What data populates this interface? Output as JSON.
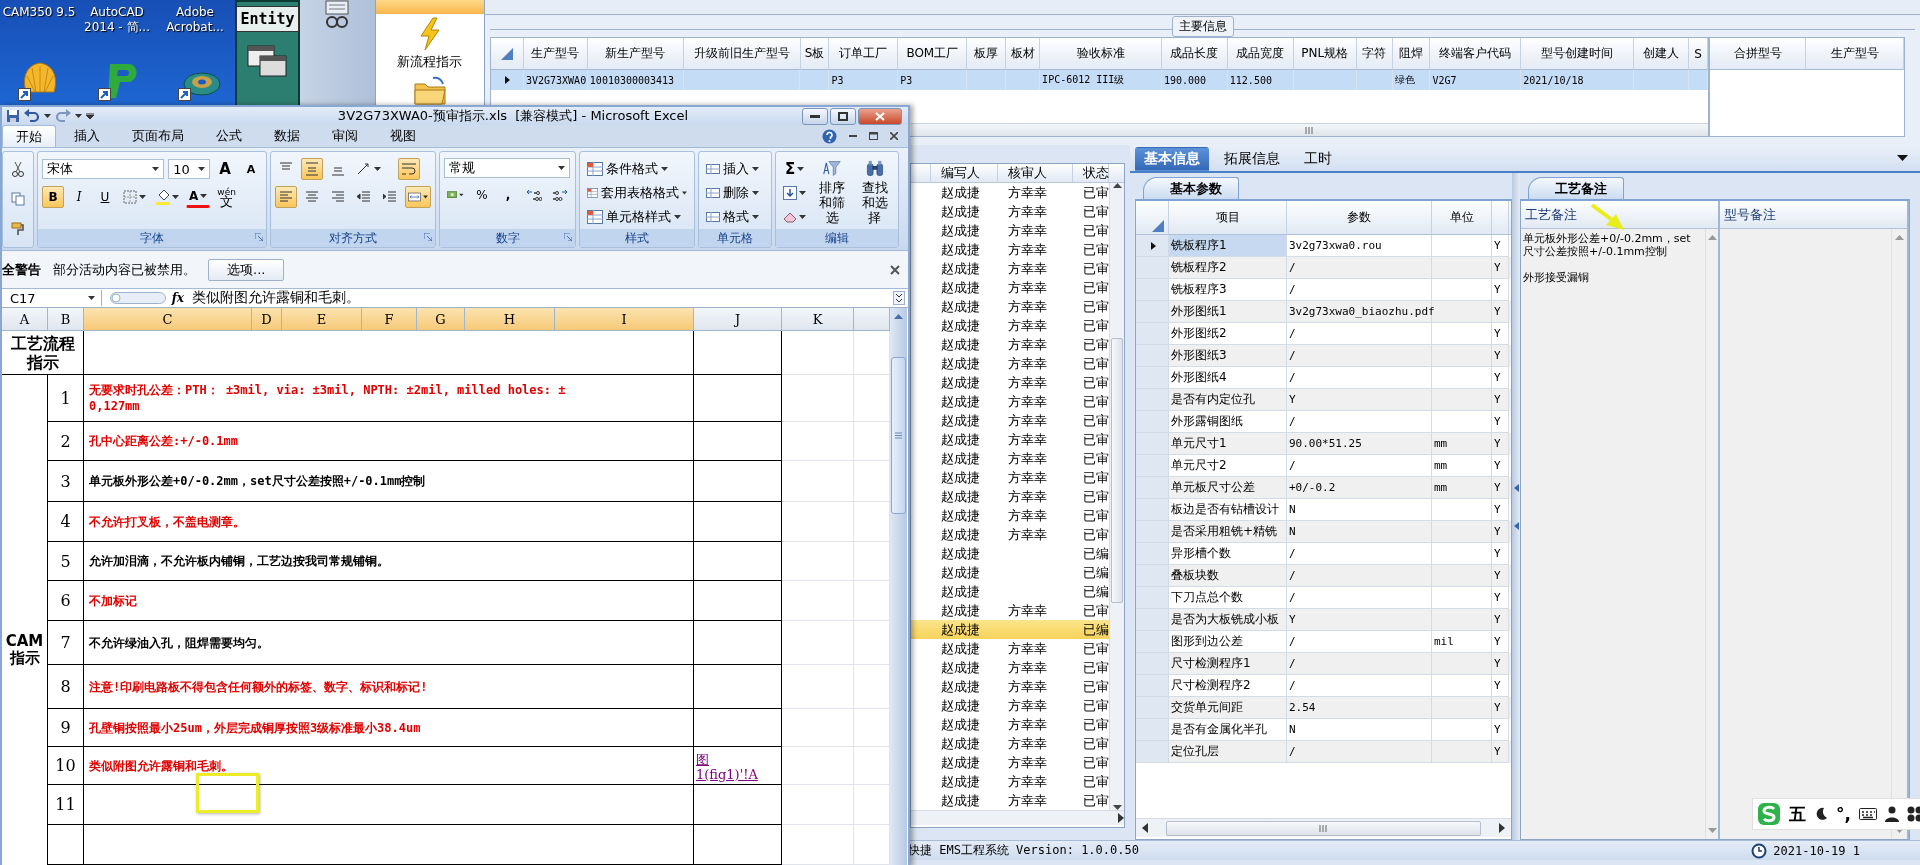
{
  "desktop_icons": [
    {
      "label": "CAM350 9.5"
    },
    {
      "label": "AutoCAD\n2014 - 简..."
    },
    {
      "label": "Adobe\nAcrobat..."
    }
  ],
  "entity_window": {
    "title": "Entity"
  },
  "nav_panel": {
    "items": [
      {
        "label": "新流程指示"
      }
    ]
  },
  "main_info": {
    "caption": "主要信息",
    "row": {
      "selected": true
    },
    "columns": [
      {
        "label": "生产型号",
        "value": "3V2G73XWA0"
      },
      {
        "label": "新生产型号",
        "value": "10010300003413"
      },
      {
        "label": "升级前旧生产型号"
      },
      {
        "label": "S板"
      },
      {
        "label": "订单工厂",
        "value": "P3"
      },
      {
        "label": "BOM工厂",
        "value": "P3"
      },
      {
        "label": "板厚"
      },
      {
        "label": "板材"
      },
      {
        "label": "验收标准",
        "value": "IPC-6012 III级"
      },
      {
        "label": "成品长度",
        "value": "190.000"
      },
      {
        "label": "成品宽度",
        "value": "112.500"
      },
      {
        "label": "PNL规格"
      },
      {
        "label": "字符"
      },
      {
        "label": "阻焊",
        "value": "绿色"
      },
      {
        "label": "终端客户代码",
        "value": "V2G7"
      },
      {
        "label": "型号创建时间",
        "value": "2021/10/18"
      },
      {
        "label": "创建人"
      },
      {
        "label": "S"
      }
    ]
  },
  "side_table": {
    "columns": [
      "合拼型号",
      "生产型号"
    ]
  },
  "excel": {
    "title": "3V2G73XWA0-预审指示.xls  [兼容模式] - Microsoft Excel",
    "tabs": [
      {
        "label": "开始",
        "selected": true
      },
      {
        "label": "插入",
        "selected": false
      },
      {
        "label": "页面布局",
        "selected": false
      },
      {
        "label": "公式",
        "selected": false
      },
      {
        "label": "数据",
        "selected": false
      },
      {
        "label": "审阅",
        "selected": false
      },
      {
        "label": "视图",
        "selected": false
      }
    ],
    "ribbon": {
      "font": "宋体",
      "font_size": "10",
      "grow_font": "A",
      "shrink_font": "A",
      "font_color": "A",
      "phonetic_top": "wén",
      "phonetic": "文",
      "format_buttons": [
        {
          "label": "B",
          "on": true
        },
        {
          "label": "I",
          "on": false
        },
        {
          "label": "U",
          "on": false
        }
      ],
      "align_buttons": [
        {
          "kind": "top",
          "on": false
        },
        {
          "kind": "middle",
          "on": true
        },
        {
          "kind": "bottom",
          "on": false
        },
        {
          "kind": "left",
          "on": true
        },
        {
          "kind": "center",
          "on": false
        },
        {
          "kind": "right",
          "on": false
        }
      ],
      "wrap_on": true,
      "merge_on": true,
      "number_format": "常规",
      "percent": "%",
      "comma": ",",
      "style_buttons": [
        "条件格式",
        "套用表格格式",
        "单元格样式"
      ],
      "cell_buttons": [
        "插入",
        "删除",
        "格式"
      ],
      "sum": "Σ",
      "edit_buttons": [
        "排序和筛选",
        "查找和选择"
      ],
      "groups": [
        "字体",
        "对齐方式",
        "数字",
        "样式",
        "单元格",
        "编辑"
      ]
    },
    "security_bar": {
      "title": "全警告",
      "message": "部分活动内容已被禁用。",
      "button": "选项..."
    },
    "formula_bar": {
      "cell": "C17",
      "fx": "fx",
      "content": "类似附图允许露铜和毛刺。"
    },
    "sheet": {
      "columns": [
        {
          "label": "A",
          "selected": false
        },
        {
          "label": "B",
          "selected": false
        },
        {
          "label": "C",
          "selected": true
        },
        {
          "label": "D",
          "selected": true
        },
        {
          "label": "E",
          "selected": true
        },
        {
          "label": "F",
          "selected": true
        },
        {
          "label": "G",
          "selected": true
        },
        {
          "label": "H",
          "selected": true
        },
        {
          "label": "I",
          "selected": true
        },
        {
          "label": "J",
          "selected": false
        },
        {
          "label": "K",
          "selected": false
        }
      ],
      "header": "工艺流程指示",
      "section": "CAM\n指示",
      "rows": [
        {
          "number": "1",
          "text": "无要求时孔公差：PTH： ±3mil, via: ±3mil, NPTH: ±2mil, milled holes: ±\n0,127mm",
          "color": "#e00000"
        },
        {
          "number": "2",
          "text": "孔中心距离公差:+/-0.1mm",
          "color": "#e00000"
        },
        {
          "number": "3",
          "text": "单元板外形公差+0/-0.2mm，set尺寸公差按照+/-0.1mm控制",
          "color": "#000000"
        },
        {
          "number": "4",
          "text": "不允许打叉板，不盖电测章。",
          "color": "#e00000"
        },
        {
          "number": "5",
          "text": "允许加泪滴，不允许板内铺铜，工艺边按我司常规铺铜。",
          "color": "#000000"
        },
        {
          "number": "6",
          "text": "不加标记",
          "color": "#e00000"
        },
        {
          "number": "7",
          "text": "不允许绿油入孔，阻焊需要均匀。",
          "color": "#000000"
        },
        {
          "number": "8",
          "text": "注意!印刷电路板不得包含任何额外的标签、数字、标识和标记!",
          "color": "#e00000"
        },
        {
          "number": "9",
          "text": "孔壁铜按照最小25um，外层完成铜厚按照3级标准最小38.4um",
          "color": "#e00000"
        },
        {
          "number": "10",
          "text": "类似附图允许露铜和毛刺。",
          "color": "#e00000",
          "link": "图\n1(fig1)'!A"
        },
        {
          "number": "11"
        }
      ]
    }
  },
  "list": {
    "columns": [
      "编写人",
      "核审人",
      "状态"
    ],
    "rows": [
      {
        "writer": "赵成捷",
        "reviewer": "方幸幸",
        "status": "已审",
        "selected": false
      },
      {
        "writer": "赵成捷",
        "reviewer": "方幸幸",
        "status": "已审",
        "selected": false
      },
      {
        "writer": "赵成捷",
        "reviewer": "方幸幸",
        "status": "已审",
        "selected": false
      },
      {
        "writer": "赵成捷",
        "reviewer": "方幸幸",
        "status": "已审",
        "selected": false
      },
      {
        "writer": "赵成捷",
        "reviewer": "方幸幸",
        "status": "已审",
        "selected": false
      },
      {
        "writer": "赵成捷",
        "reviewer": "方幸幸",
        "status": "已审",
        "selected": false
      },
      {
        "writer": "赵成捷",
        "reviewer": "方幸幸",
        "status": "已审",
        "selected": false
      },
      {
        "writer": "赵成捷",
        "reviewer": "方幸幸",
        "status": "已审",
        "selected": false
      },
      {
        "writer": "赵成捷",
        "reviewer": "方幸幸",
        "status": "已审",
        "selected": false
      },
      {
        "writer": "赵成捷",
        "reviewer": "方幸幸",
        "status": "已审",
        "selected": false
      },
      {
        "writer": "赵成捷",
        "reviewer": "方幸幸",
        "status": "已审",
        "selected": false
      },
      {
        "writer": "赵成捷",
        "reviewer": "方幸幸",
        "status": "已审",
        "selected": false
      },
      {
        "writer": "赵成捷",
        "reviewer": "方幸幸",
        "status": "已审",
        "selected": false
      },
      {
        "writer": "赵成捷",
        "reviewer": "方幸幸",
        "status": "已审",
        "selected": false
      },
      {
        "writer": "赵成捷",
        "reviewer": "方幸幸",
        "status": "已审",
        "selected": false
      },
      {
        "writer": "赵成捷",
        "reviewer": "方幸幸",
        "status": "已审",
        "selected": false
      },
      {
        "writer": "赵成捷",
        "reviewer": "方幸幸",
        "status": "已审",
        "selected": false
      },
      {
        "writer": "赵成捷",
        "reviewer": "方幸幸",
        "status": "已审",
        "selected": false
      },
      {
        "writer": "赵成捷",
        "reviewer": "方幸幸",
        "status": "已审",
        "selected": false
      },
      {
        "writer": "赵成捷",
        "status": "已编",
        "selected": false
      },
      {
        "writer": "赵成捷",
        "status": "已编",
        "selected": false
      },
      {
        "writer": "赵成捷",
        "status": "已编",
        "selected": false
      },
      {
        "writer": "赵成捷",
        "reviewer": "方幸幸",
        "status": "已审",
        "selected": false
      },
      {
        "writer": "赵成捷",
        "status": "已编",
        "selected": true
      },
      {
        "writer": "赵成捷",
        "reviewer": "方幸幸",
        "status": "已审",
        "selected": false
      },
      {
        "writer": "赵成捷",
        "reviewer": "方幸幸",
        "status": "已审",
        "selected": false
      },
      {
        "writer": "赵成捷",
        "reviewer": "方幸幸",
        "status": "已审",
        "selected": false
      },
      {
        "writer": "赵成捷",
        "reviewer": "方幸幸",
        "status": "已审",
        "selected": false
      },
      {
        "writer": "赵成捷",
        "reviewer": "方幸幸",
        "status": "已审",
        "selected": false
      },
      {
        "writer": "赵成捷",
        "reviewer": "方幸幸",
        "status": "已审",
        "selected": false
      },
      {
        "writer": "赵成捷",
        "reviewer": "方幸幸",
        "status": "已审",
        "selected": false
      },
      {
        "writer": "赵成捷",
        "reviewer": "方幸幸",
        "status": "已审",
        "selected": false
      },
      {
        "writer": "赵成捷",
        "reviewer": "方幸幸",
        "status": "已审",
        "selected": false
      }
    ]
  },
  "info_tabs": [
    {
      "label": "基本信息",
      "selected": true
    },
    {
      "label": "拓展信息",
      "selected": false
    },
    {
      "label": "工时",
      "selected": false
    }
  ],
  "params": {
    "tab": "基本参数",
    "columns": [
      "项目",
      "参数",
      "单位"
    ],
    "rows": [
      {
        "item": "铣板程序1",
        "value": "3v2g73xwa0.rou",
        "flag": "Y",
        "selected": true
      },
      {
        "item": "铣板程序2",
        "value": "/",
        "flag": "Y",
        "selected": false
      },
      {
        "item": "铣板程序3",
        "value": "/",
        "flag": "Y",
        "selected": false
      },
      {
        "item": "外形图纸1",
        "value": "3v2g73xwa0_biaozhu.pdf",
        "flag": "Y",
        "selected": false
      },
      {
        "item": "外形图纸2",
        "value": "/",
        "flag": "Y",
        "selected": false
      },
      {
        "item": "外形图纸3",
        "value": "/",
        "flag": "Y",
        "selected": false
      },
      {
        "item": "外形图纸4",
        "value": "/",
        "flag": "Y",
        "selected": false
      },
      {
        "item": "是否有内定位孔",
        "value": "Y",
        "flag": "Y",
        "selected": false
      },
      {
        "item": "外形露铜图纸",
        "value": "/",
        "flag": "Y",
        "selected": false
      },
      {
        "item": "单元尺寸1",
        "value": "90.00*51.25",
        "unit": "mm",
        "flag": "Y",
        "selected": false
      },
      {
        "item": "单元尺寸2",
        "value": "/",
        "unit": "mm",
        "flag": "Y",
        "selected": false
      },
      {
        "item": "单元板尺寸公差",
        "value": "+0/-0.2",
        "unit": "mm",
        "flag": "Y",
        "selected": false
      },
      {
        "item": "板边是否有钻槽设计",
        "value": "N",
        "flag": "Y",
        "selected": false
      },
      {
        "item": "是否采用粗铣+精铣",
        "value": "N",
        "flag": "Y",
        "selected": false
      },
      {
        "item": "异形槽个数",
        "value": "/",
        "flag": "Y",
        "selected": false
      },
      {
        "item": "叠板块数",
        "value": "/",
        "flag": "Y",
        "selected": false
      },
      {
        "item": "下刀点总个数",
        "value": "/",
        "flag": "Y",
        "selected": false
      },
      {
        "item": "是否为大板铣成小板",
        "value": "Y",
        "flag": "Y",
        "selected": false
      },
      {
        "item": "图形到边公差",
        "value": "/",
        "unit": "mil",
        "flag": "Y",
        "selected": false
      },
      {
        "item": "尺寸检测程序1",
        "value": "/",
        "flag": "Y",
        "selected": false
      },
      {
        "item": "尺寸检测程序2",
        "value": "/",
        "flag": "Y",
        "selected": false
      },
      {
        "item": "交货单元间距",
        "value": "2.54",
        "flag": "Y",
        "selected": false
      },
      {
        "item": "是否有金属化半孔",
        "value": "N",
        "flag": "Y",
        "selected": false
      },
      {
        "item": "定位孔层",
        "value": "/",
        "flag": "Y",
        "selected": false
      }
    ]
  },
  "notes": {
    "tab": "工艺备注",
    "columns": [
      "工艺备注",
      "型号备注"
    ],
    "paragraphs": [
      "单元板外形公差+0/-0.2mm，set 尺寸公差按照+/-0.1mm控制",
      "外形接受漏铜"
    ]
  },
  "status_bar": {
    "app": "快捷 EMS工程系统 Version: 1.0.0.50",
    "datetime": "2021-10-19 1"
  },
  "ime_bar": {
    "mode": "五",
    "punct": "°,"
  }
}
